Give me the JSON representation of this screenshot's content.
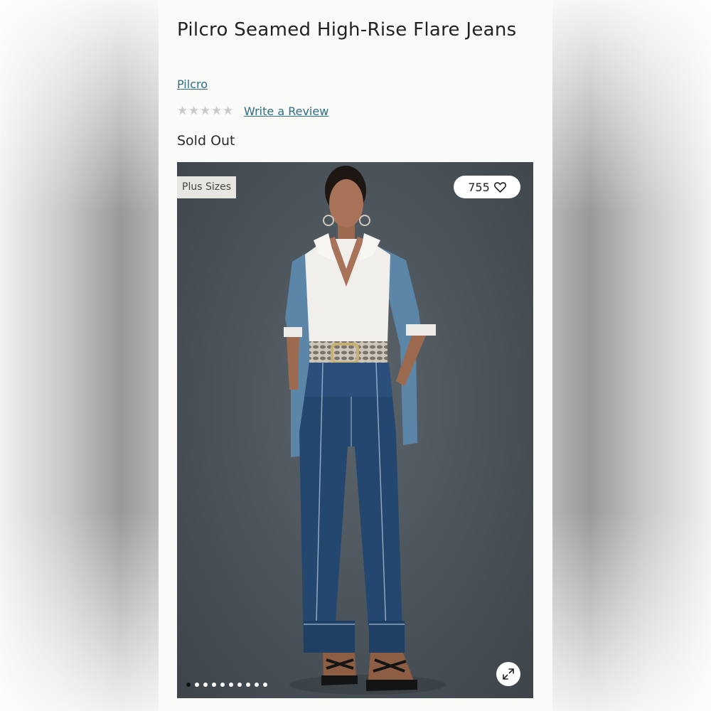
{
  "product": {
    "title": "Pilcro Seamed High-Rise Flare Jeans",
    "brand": "Pilcro",
    "rating": {
      "stars_filled": 0,
      "stars_total": 5,
      "review_link": "Write a Review"
    },
    "availability": "Sold Out"
  },
  "gallery": {
    "badge": "Plus Sizes",
    "likes": "755",
    "like_icon": "heart-icon",
    "expand_icon": "expand-icon",
    "dots_total": 10,
    "active_dot": 1
  },
  "colors": {
    "link": "#2e6f86",
    "background": "#fafaf8",
    "image_background": "#4b535a"
  }
}
